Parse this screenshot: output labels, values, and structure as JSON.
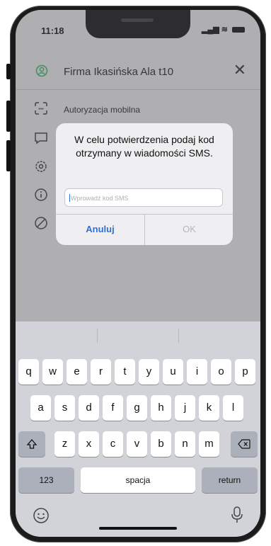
{
  "status_bar": {
    "time": "11:18"
  },
  "header": {
    "title": "Firma Ikasińska Ala t10",
    "close_glyph": "✕"
  },
  "menu": {
    "mobile_auth_label": "Autoryzacja mobilna"
  },
  "dialog": {
    "message": "W celu potwierdzenia podaj kod otrzymany w wiadomości SMS.",
    "input_placeholder": "Wprowadź kod SMS",
    "cancel_label": "Anuluj",
    "ok_label": "OK"
  },
  "keyboard": {
    "row1": [
      "q",
      "w",
      "e",
      "r",
      "t",
      "y",
      "u",
      "i",
      "o",
      "p"
    ],
    "row2": [
      "a",
      "s",
      "d",
      "f",
      "g",
      "h",
      "j",
      "k",
      "l"
    ],
    "row3": [
      "z",
      "x",
      "c",
      "v",
      "b",
      "n",
      "m"
    ],
    "numbers_label": "123",
    "space_label": "spacja",
    "return_label": "return"
  },
  "colors": {
    "accent": "#2f6fd6",
    "brand_green": "#2e9a5a"
  },
  "icons": [
    "user-icon",
    "close-icon",
    "mobile-auth-icon",
    "chat-icon",
    "settings-icon",
    "info-icon",
    "block-icon",
    "shift-icon",
    "backspace-icon",
    "emoji-icon",
    "microphone-icon"
  ]
}
